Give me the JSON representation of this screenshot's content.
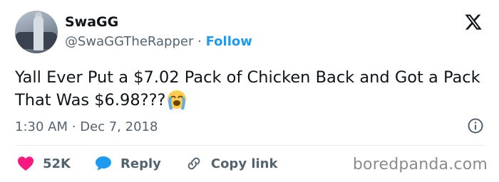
{
  "author": {
    "display_name": "SwaGG",
    "handle": "@SwaGGTheRapper",
    "separator": "·",
    "follow_label": "Follow"
  },
  "tweet": {
    "text": "Yall Ever Put a $7.02 Pack of Chicken Back and Got a Pack That Was $6.98???",
    "emoji": "loudly-crying-face",
    "time": "1:30 AM",
    "separator": "·",
    "date": "Dec 7, 2018"
  },
  "actions": {
    "likes_count": "52K",
    "reply_label": "Reply",
    "copy_link_label": "Copy link"
  },
  "icons": {
    "platform": "x-logo-icon",
    "info": "info-icon",
    "like": "heart-icon",
    "reply": "speech-bubble-icon",
    "copy": "link-icon"
  },
  "watermark": "boredpanda.com",
  "colors": {
    "link_blue": "#1d9bf0",
    "heart_red": "#f91880",
    "muted_gray": "#536471",
    "text": "#0f1419"
  }
}
